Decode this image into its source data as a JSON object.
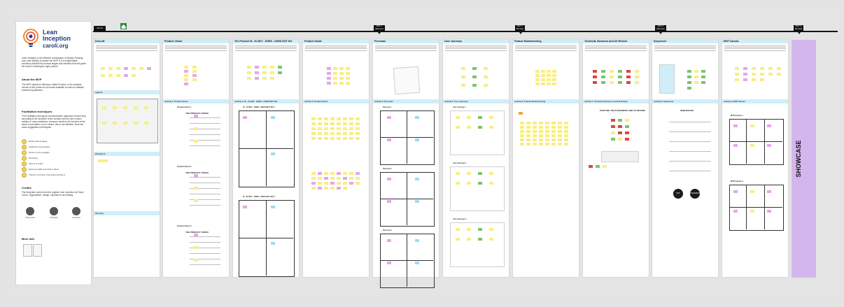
{
  "left_panel": {
    "logo_title_1": "Lean",
    "logo_title_2": "Inception",
    "logo_sub": "caroli.org",
    "intro": "Lean Inception is the effective combination of Design Thinking and Lean StartUp to decide the MVP. It is a collaborative workshop divided into several stages and activities that will guide the team in building the right product.",
    "about_mvp_head": "About the MVP",
    "about_mvp_text": "The MVP stands for Minimum Viable Product, is the simplest version of the product to be made available to users to validate business hypotheses.",
    "facilitation_head": "Facilitation techniques",
    "facilitation_text": "The Facilitation and group communication approach of each step according to the structure of the content and the size of each activity. In many situations, everyone needs to be involved in the same conversation, but in others, this is not effective. Here are some suggestions techniques:",
    "techniques": [
      "Divide and Conquer",
      "Fishbowl Conversation",
      "Person in the spotlight",
      "Dotvoting",
      "Tell me 3 Crazy",
      "Everyone talks and write it down",
      "Thumb 1-2-3 How I feel about activity 4"
    ],
    "credits_head": "Credits",
    "credits_text": "This template comes from the original Lean Inception by Paulo Caroli. Organization, design, experience and testing",
    "avatars": [
      "Paulo Caroli",
      "Contributor",
      "Contributor"
    ],
    "more_info_head": "More info"
  },
  "timeline": {
    "kickoff_tag": "Kick-off",
    "days": [
      {
        "label": "DAY 1",
        "sub": "Afternoon"
      },
      {
        "label": "DAY 2",
        "sub": "Morning"
      },
      {
        "label": "DAY 3",
        "sub": "Afternoon"
      },
      {
        "label": "DAY 4",
        "sub": "Morning"
      },
      {
        "label": "DAY 5",
        "sub": "Friday"
      }
    ]
  },
  "columns": [
    {
      "title": "Kick-off",
      "bands": [
        "Agenda",
        "Parking lot",
        "Glossary"
      ]
    },
    {
      "title": "Product Vision",
      "bands": [
        "Activity 1: Product Vision"
      ]
    },
    {
      "title": "The Product IS - IS NOT - DOES - DOES NOT DO",
      "bands": [
        "Activity 2: IS - IS NOT - DOES - DOES NOT DO"
      ]
    },
    {
      "title": "Product Goals",
      "bands": [
        "Activity 3: Product Goals"
      ]
    },
    {
      "title": "Personas",
      "bands": [
        "Activity 4: Personas"
      ]
    },
    {
      "title": "User Journeys",
      "bands": [
        "Activity 5: User Journeys"
      ]
    },
    {
      "title": "Feature Brainstorming",
      "bands": [
        "Activity 6: Feature Brainstorming"
      ]
    },
    {
      "title": "Technical, Business and UX Review",
      "bands": [
        "Activity 7: Technical, Business and UX Review"
      ]
    },
    {
      "title": "Sequencer",
      "bands": [
        "Activity 8: Sequencer"
      ]
    },
    {
      "title": "MVP Canvas",
      "bands": [
        "Activity 9: MVP Canvas"
      ]
    }
  ],
  "mini": {
    "vision_heads": [
      "Product Vision 1",
      "Product Vision 2",
      "Product Vision 3"
    ],
    "vision_tpl": "THE PRODUCT VISION",
    "isnot_heads": [
      "IS - IS NOT - DOES - DOES NOT DO 1",
      "IS - IS NOT - DOES - DOES NOT DO 2"
    ],
    "persona_heads": [
      "Persona 1",
      "Persona 2",
      "Persona 3"
    ],
    "journey_heads": [
      "User Journey 1",
      "User Journey 2",
      "User Journey 3"
    ],
    "review_head": "FEATURE, TECH BUSINESS AND UX REVIEW",
    "sequencer_head": "SEQUENCER",
    "sequencer_circles": [
      "MVP",
      "INCREMENT"
    ],
    "mvp_heads": [
      "MVP Canvas 1",
      "MVP Canvas 2"
    ]
  },
  "showcase_label": "SHOWCASE"
}
